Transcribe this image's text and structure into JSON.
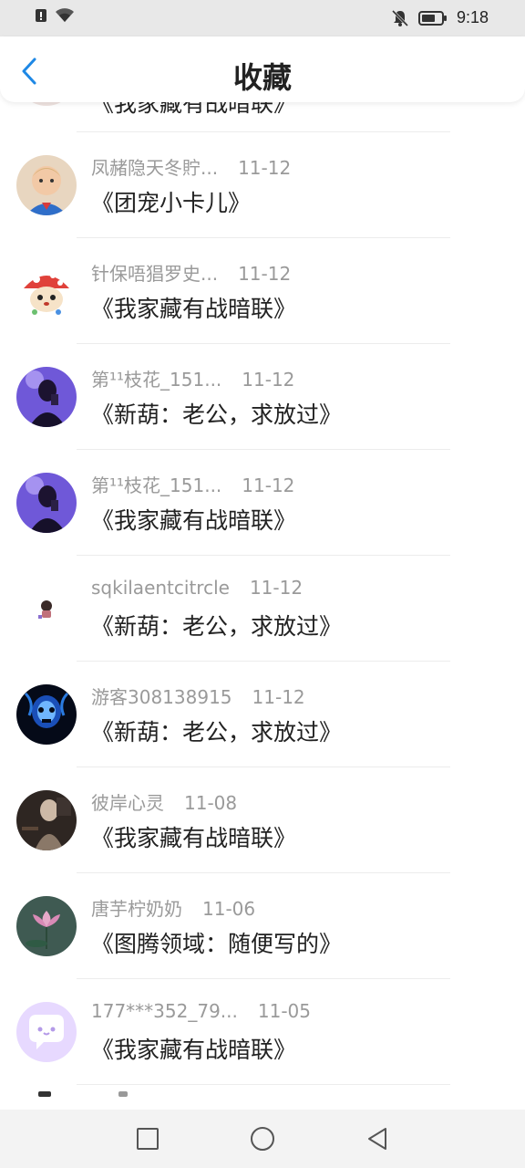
{
  "status_bar": {
    "time": "9:18",
    "icons": [
      "alert-icon",
      "wifi-icon",
      "bell-muted-icon",
      "battery-icon"
    ]
  },
  "header": {
    "title": "收藏",
    "back_icon": "chevron-left-icon",
    "accent_color": "#1e88e5"
  },
  "partial_top_item": {
    "book": "《我家藏有战暗联》"
  },
  "items": [
    {
      "user": "凤赭隐天冬貯...",
      "date": "11-12",
      "book": "《团宠小卡儿》",
      "avatar": "baby-photo"
    },
    {
      "user": "针保唔猖罗史...",
      "date": "11-12",
      "book": "《我家藏有战暗联》",
      "avatar": "cartoon-hamster"
    },
    {
      "user": "第¹¹枝花_151...",
      "date": "11-12",
      "book": "《新葫：老公，求放过》",
      "avatar": "purple-portrait"
    },
    {
      "user": "第¹¹枝花_151...",
      "date": "11-12",
      "book": "《我家藏有战暗联》",
      "avatar": "purple-portrait"
    },
    {
      "user": "sqkilaentcitrcle",
      "date": "11-12",
      "book": "《新葫：老公，求放过》",
      "avatar": "small-figure"
    },
    {
      "user": "游客308138915",
      "date": "11-12",
      "book": "《新葫：老公，求放过》",
      "avatar": "blue-skull"
    },
    {
      "user": "彼岸心灵",
      "date": "11-08",
      "book": "《我家藏有战暗联》",
      "avatar": "dark-photo"
    },
    {
      "user": "唐芋柠奶奶",
      "date": "11-06",
      "book": "《图腾领域：随便写的》",
      "avatar": "lotus-flower"
    },
    {
      "user": "177***352_79...",
      "date": "11-05",
      "book": "《我家藏有战暗联》",
      "avatar": "chat-bubble-default"
    }
  ],
  "nav_bar": {
    "buttons": [
      "recent-apps-icon",
      "home-icon",
      "back-triangle-icon"
    ]
  }
}
